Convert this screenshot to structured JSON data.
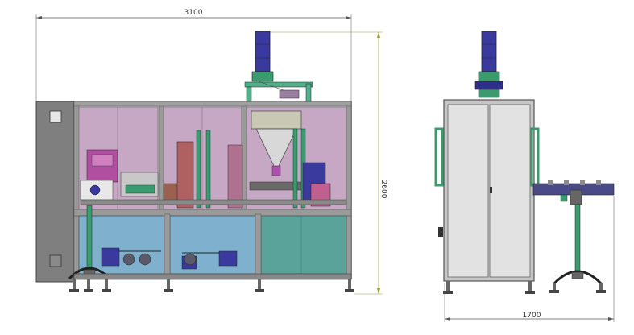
{
  "dimensions": {
    "width_front": "3100",
    "height_front": "2600",
    "width_side": "1700"
  },
  "colors": {
    "frame": "#8c8c8c",
    "cabinet": "#7f7f7f",
    "upper_glass": "#c7a8c4",
    "lower_glass": "#7fb1cf",
    "hopper_motor": "#3a3a9e",
    "green_post": "#3a9b6f",
    "side_panel": "#d9d9d9",
    "conveyor": "#4a4a86",
    "dim_line": "#555555",
    "dim_line_yellow": "#9a9a3a"
  }
}
